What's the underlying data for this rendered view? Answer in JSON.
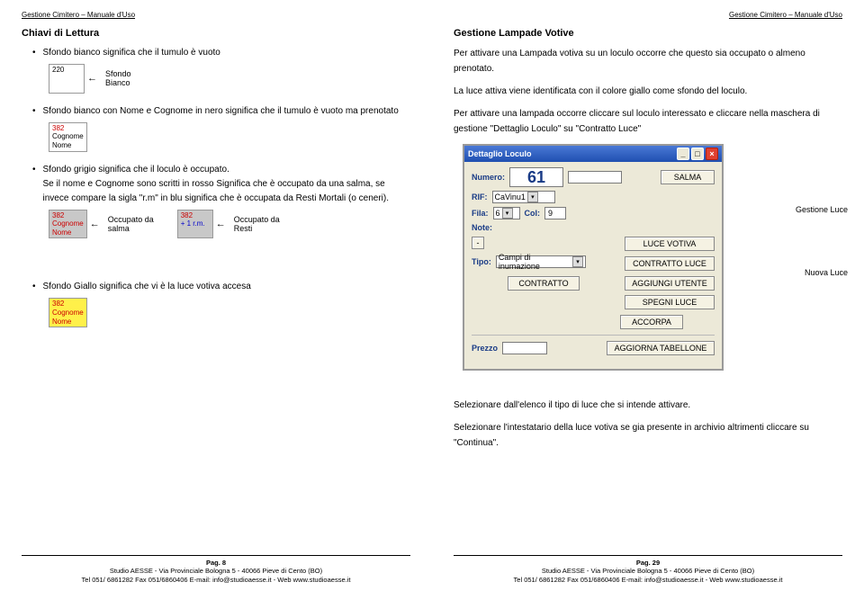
{
  "header_text": "Gestione Cimitero – Manuale d'Uso",
  "left": {
    "title": "Chiavi di Lettura",
    "bullet1": "Sfondo bianco significa che il tumulo è vuoto",
    "cell1_num": "220",
    "cell1_label_line1": "Sfondo",
    "cell1_label_line2": "Bianco",
    "bullet2": "Sfondo bianco con Nome e Cognome in nero significa che il tumulo è vuoto ma prenotato",
    "cell2_num": "382",
    "cell2_line1": "Cognome",
    "cell2_line2": "Nome",
    "bullet3_p1": "Sfondo grigio significa che il loculo è occupato.",
    "bullet3_p2": "Se il nome e Cognome sono scritti in rosso Significa che è occupato da una salma, se invece compare la sigla \"r.m\" in blu significa che è occupata da Resti Mortali (o ceneri).",
    "cell3a_num": "382",
    "cell3a_line1": "Cognome",
    "cell3a_line2": "Nome",
    "cell3a_label_line1": "Occupato da",
    "cell3a_label_line2": "salma",
    "cell3b_num": "382",
    "cell3b_line1": "+ 1 r.m.",
    "cell3b_label_line1": "Occupato da",
    "cell3b_label_line2": "Resti",
    "bullet4": "Sfondo Giallo significa che vi è la luce votiva accesa",
    "cell4_num": "382",
    "cell4_line1": "Cognome",
    "cell4_line2": "Nome",
    "footer_page": "Pag. 8",
    "footer_line2": "Studio AESSE - Via Provinciale Bologna 5 - 40066 Pieve di Cento (BO)",
    "footer_line3": "Tel 051/ 6861282  Fax 051/6860406  E-mail: info@studioaesse.it  -  Web www.studioaesse.it"
  },
  "right": {
    "title": "Gestione Lampade Votive",
    "p1": "Per attivare una Lampada votiva su un loculo occorre che questo sia occupato o almeno prenotato.",
    "p2": "La luce attiva viene identificata con il colore giallo come sfondo del loculo.",
    "p3": "Per attivare una lampada occorre cliccare sul loculo interessato e cliccare nella maschera di gestione \"Dettaglio Loculo\" su \"Contratto Luce\"",
    "dialog": {
      "title": "Dettaglio Loculo",
      "lbl_numero": "Numero:",
      "val_numero": "61",
      "btn_salma": "SALMA",
      "lbl_rif": "RIF:",
      "val_rif": "CaVinu1",
      "lbl_fila": "Fila:",
      "val_fila": "6",
      "lbl_col": "Col:",
      "val_col": "9",
      "lbl_note": "Note:",
      "lbl_tipo": "Tipo:",
      "val_tipo": "Campi di inumazione",
      "btn_luce_votiva": "LUCE VOTIVA",
      "btn_contratto_luce": "CONTRATTO LUCE",
      "btn_contratto": "CONTRATTO",
      "btn_aggiungi_utente": "AGGIUNGI UTENTE",
      "btn_spegni_luce": "SPEGNI LUCE",
      "btn_accorpa": "ACCORPA",
      "lbl_prezzo": "Prezzo",
      "btn_aggiorna_tabellone": "AGGIORNA TABELLONE"
    },
    "side_note1": "Gestione Luce",
    "side_note2": "Nuova Luce",
    "p4": "Selezionare dall'elenco il tipo di luce  che si intende attivare.",
    "p5": "Selezionare l'intestatario della luce votiva se gia presente in archivio altrimenti cliccare su \"Continua\".",
    "footer_page": "Pag. 29",
    "footer_line2": "Studio AESSE - Via Provinciale Bologna 5 - 40066 Pieve di Cento (BO)",
    "footer_line3": "Tel 051/ 6861282  Fax 051/6860406  E-mail: info@studioaesse.it  -  Web www.studioaesse.it"
  }
}
